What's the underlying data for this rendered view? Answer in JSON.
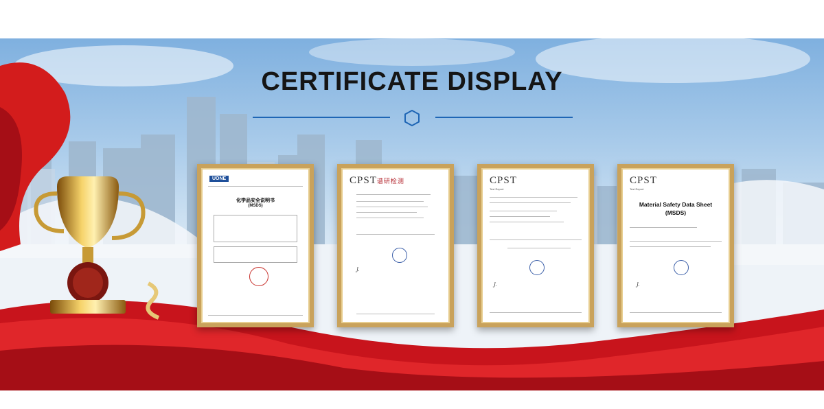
{
  "heading": "CERTIFICATE DISPLAY",
  "colors": {
    "accent_line": "#1f66b5",
    "frame_gold": "#c9a25b",
    "ribbon_red": "#d31c1c"
  },
  "certificates": [
    {
      "logo": "UONE",
      "title_cn": "化学品安全说明书",
      "title_en": "(MSDS)"
    },
    {
      "logo": "CPST",
      "logo_cn": "谱研检测"
    },
    {
      "logo": "CPST",
      "subtitle": "Test Report"
    },
    {
      "logo": "CPST",
      "subtitle": "Test Report",
      "title_line1": "Material Safety Data Sheet",
      "title_line2": "(MSDS)"
    }
  ],
  "icons": [
    "hexagon-icon",
    "trophy-icon",
    "ribbon-icon"
  ]
}
